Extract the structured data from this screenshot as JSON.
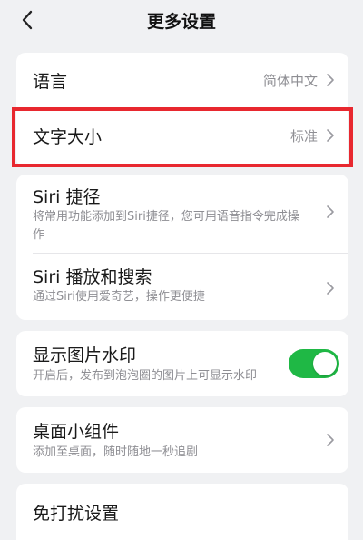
{
  "header": {
    "title": "更多设置",
    "back_icon": "chevron-left-icon"
  },
  "settings": {
    "language": {
      "title": "语言",
      "value": "简体中文"
    },
    "font_size": {
      "title": "文字大小",
      "value": "标准"
    },
    "siri_shortcut": {
      "title": "Siri 捷径",
      "subtitle": "将常用功能添加到Siri捷径，您可用语音指令完成操作"
    },
    "siri_play_search": {
      "title": "Siri 播放和搜索",
      "subtitle": "通过Siri使用爱奇艺，操作更便捷"
    },
    "watermark": {
      "title": "显示图片水印",
      "subtitle": "开启后，发布到泡泡圈的图片上可显示水印",
      "enabled": true
    },
    "widget": {
      "title": "桌面小组件",
      "subtitle": "添加至桌面，随时随地一秒追剧"
    },
    "dnd": {
      "title": "免打扰设置"
    }
  },
  "colors": {
    "background": "#f0f1f3",
    "card": "#ffffff",
    "toggle_on": "#1fb845",
    "highlight": "#e8282f",
    "secondary_text": "#8e8e93"
  }
}
